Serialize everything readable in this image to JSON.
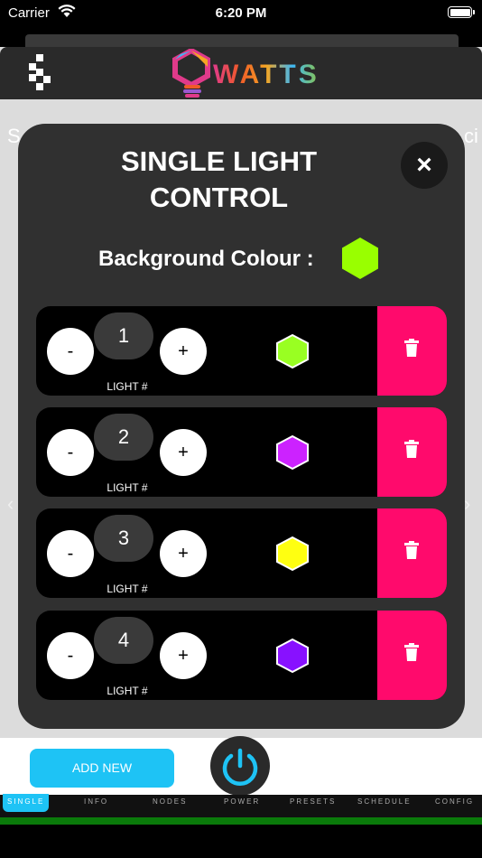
{
  "status_bar": {
    "carrier": "Carrier",
    "time": "6:20 PM"
  },
  "header": {
    "logo_text": "WATTS"
  },
  "background_page": {
    "left_text": "S",
    "right_text": "ci"
  },
  "modal": {
    "title_line1": "SINGLE LIGHT",
    "title_line2": "CONTROL",
    "close_label": "×",
    "background_colour_label": "Background Colour :",
    "background_colour": "#99ff00",
    "lights": [
      {
        "number": "1",
        "label": "LIGHT #",
        "minus": "-",
        "plus": "+",
        "color": "#99ff22"
      },
      {
        "number": "2",
        "label": "LIGHT #",
        "minus": "-",
        "plus": "+",
        "color": "#cc22ff"
      },
      {
        "number": "3",
        "label": "LIGHT #",
        "minus": "-",
        "plus": "+",
        "color": "#ffff11"
      },
      {
        "number": "4",
        "label": "LIGHT #",
        "minus": "-",
        "plus": "+",
        "color": "#8811ff"
      }
    ]
  },
  "bottom": {
    "add_new_label": "ADD NEW",
    "tabs": [
      "SINGLE",
      "INFO",
      "NODES",
      "POWER",
      "PRESETS",
      "SCHEDULE",
      "CONFIG"
    ]
  },
  "colors": {
    "accent": "#1ec3f5",
    "delete": "#ff0a6c"
  }
}
